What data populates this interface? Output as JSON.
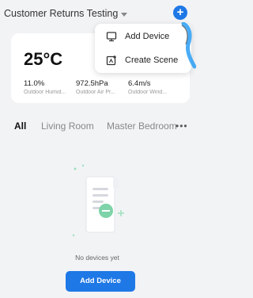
{
  "header": {
    "home_name": "Customer Returns Testing",
    "add_button_symbol": "+"
  },
  "weather": {
    "temperature": "25°C",
    "stats": [
      {
        "value": "11.0%",
        "label": "Outdoor Humid..."
      },
      {
        "value": "972.5hPa",
        "label": "Outdoor Air Pr..."
      },
      {
        "value": "6.4m/s",
        "label": "Outdoor Wind..."
      }
    ]
  },
  "menu": {
    "items": [
      {
        "label": "Add Device",
        "icon": "add-device-icon"
      },
      {
        "label": "Create Scene",
        "icon": "create-scene-icon"
      }
    ]
  },
  "tabs": {
    "items": [
      {
        "label": "All",
        "active": true
      },
      {
        "label": "Living Room",
        "active": false
      },
      {
        "label": "Master Bedroom",
        "active": false
      }
    ],
    "more_symbol": "•••"
  },
  "empty_state": {
    "message": "No devices yet",
    "button_label": "Add Device"
  },
  "colors": {
    "accent": "#1e78e6",
    "background": "#f2f3f5",
    "illustration_green": "#7ed3a8"
  }
}
